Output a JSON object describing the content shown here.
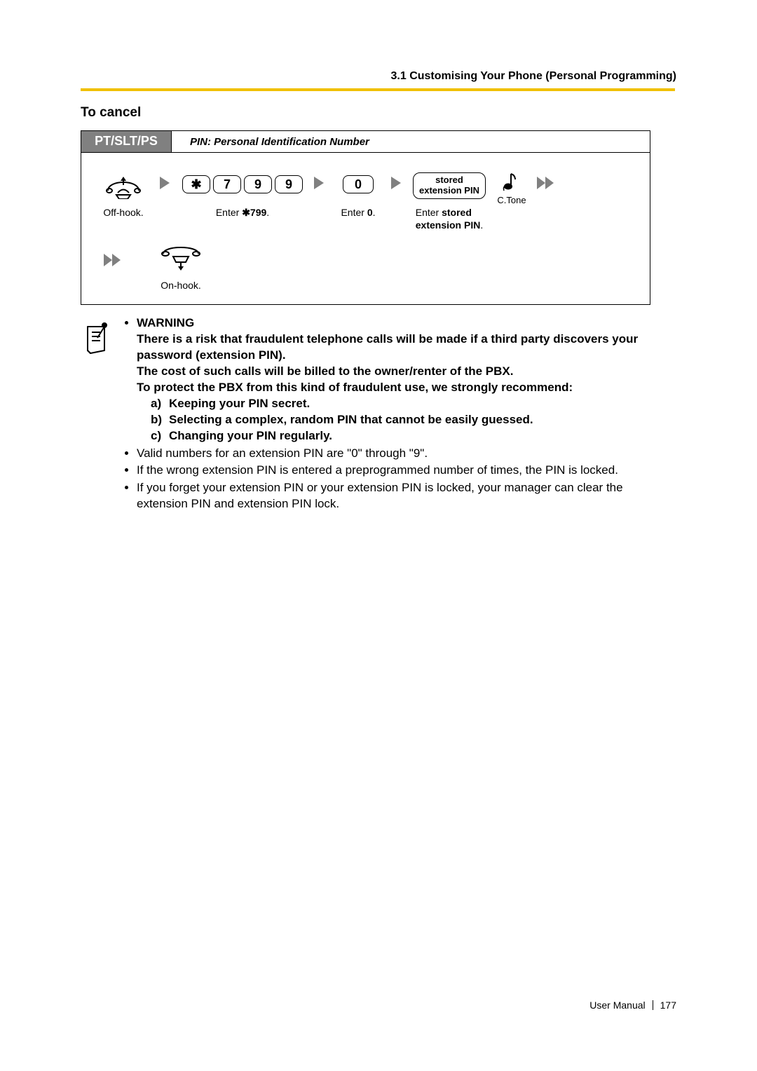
{
  "header": {
    "breadcrumb": "3.1 Customising Your Phone (Personal Programming)"
  },
  "section": {
    "title": "To cancel"
  },
  "diagram": {
    "tab": "PT/SLT/PS",
    "subtitle": "PIN: Personal Identification Number",
    "keys": {
      "star": "✱",
      "k7": "7",
      "k9a": "9",
      "k9b": "9",
      "k0": "0"
    },
    "steps": {
      "offhook": "Off-hook.",
      "enter799_pre": "Enter ",
      "enter799_bold": "✱799",
      "enter799_post": ".",
      "enter0_pre": "Enter ",
      "enter0_bold": "0",
      "enter0_post": ".",
      "stored_line1": "stored",
      "stored_line2": "extension PIN",
      "enter_stored_pre": "Enter ",
      "enter_stored_bold1": "stored",
      "enter_stored_br": "",
      "enter_stored_bold2": "extension PIN",
      "enter_stored_post": ".",
      "ctone": "C.Tone",
      "onhook": "On-hook."
    }
  },
  "notes": {
    "warning_label": "WARNING",
    "warning_p1": "There is a risk that fraudulent telephone calls will be made if a third party discovers your password (extension PIN).",
    "warning_p2": "The cost of such calls will be billed to the owner/renter of the PBX.",
    "warning_p3": "To protect the PBX from this kind of fraudulent use, we strongly recommend:",
    "rec_a_label": "a)",
    "rec_a": "Keeping your PIN secret.",
    "rec_b_label": "b)",
    "rec_b": "Selecting a complex, random PIN that cannot be easily guessed.",
    "rec_c_label": "c)",
    "rec_c": "Changing your PIN regularly.",
    "bullet2": "Valid numbers for an extension PIN are \"0\" through \"9\".",
    "bullet3": "If the wrong extension PIN is entered a preprogrammed number of times, the PIN is locked.",
    "bullet4": "If you forget your extension PIN or your extension PIN is locked, your manager can clear the extension PIN and extension PIN lock."
  },
  "footer": {
    "label": "User Manual",
    "page": "177"
  }
}
